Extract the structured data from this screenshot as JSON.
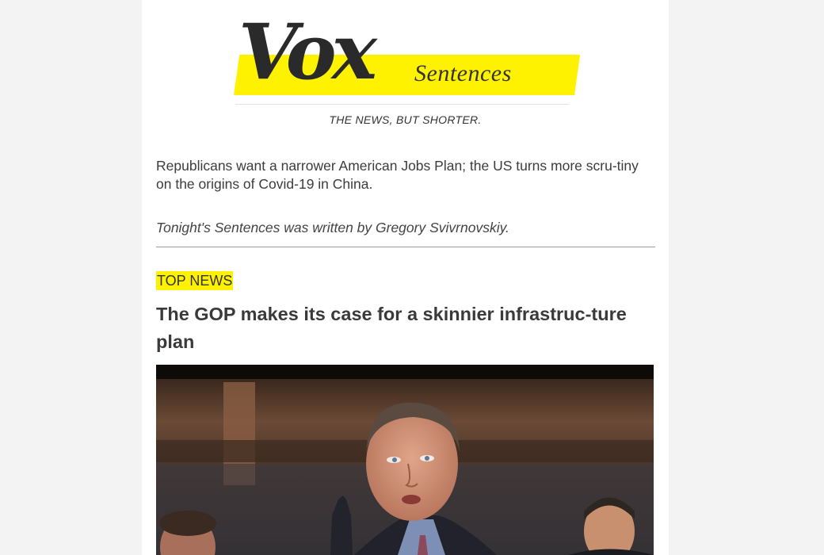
{
  "newsletter": {
    "logo_text": "Vox",
    "logo_sub": "Sentences",
    "tagline": "THE NEWS, BUT SHORTER."
  },
  "intro": {
    "summary": "Republicans want a narrower American Jobs Plan; the US turns more scru-tiny on the origins of Covid-19 in China.",
    "byline": "Tonight's Sentences was written by Gregory Svivrnovskiy."
  },
  "section": {
    "label": "TOP NEWS",
    "headline": "The GOP makes its case for a skinnier infrastruc-ture plan"
  },
  "colors": {
    "page_bg": "#f3f3f3",
    "highlight": "#fff200",
    "text": "#3c3c3c"
  }
}
